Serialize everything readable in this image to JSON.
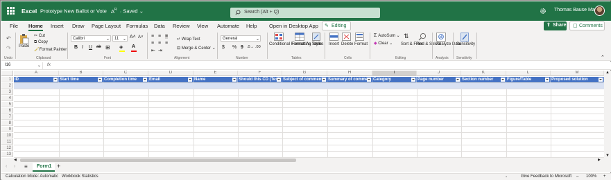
{
  "app": {
    "name": "Excel",
    "doc_title": "Prototype New Ballot or Vote",
    "sensitivity_mark": "A",
    "saved": "Saved"
  },
  "search": {
    "placeholder": "Search (Alt + Q)"
  },
  "user": {
    "name": "Thomas Bause Ma..."
  },
  "menu": {
    "tabs": [
      "File",
      "Home",
      "Insert",
      "Draw",
      "Page Layout",
      "Formulas",
      "Data",
      "Review",
      "View",
      "Automate",
      "Help",
      "Open in Desktop App"
    ],
    "active": "Home",
    "editing_label": "Editing",
    "share_label": "Share",
    "comments_label": "Comments"
  },
  "ribbon": {
    "undo_group": "Undo",
    "clipboard": {
      "paste": "Paste",
      "cut": "Cut",
      "copy": "Copy",
      "format_painter": "Format Painter",
      "group": "Clipboard"
    },
    "font": {
      "family": "Calibri",
      "size": "11",
      "bold": "B",
      "italic": "I",
      "underline": "U",
      "strike": "ab",
      "group": "Font"
    },
    "alignment": {
      "wrap_text": "Wrap Text",
      "merge_center": "Merge & Center",
      "group": "Alignment"
    },
    "number": {
      "format": "General",
      "currency": "$",
      "percent": "%",
      "comma": "9",
      "group": "Number"
    },
    "tables": {
      "conditional": "Conditional Formatting",
      "format_as": "Format As Table",
      "styles": "Styles",
      "group": "Tables"
    },
    "cells": {
      "insert": "Insert",
      "delete": "Delete",
      "format": "Format",
      "group": "Cells"
    },
    "editing": {
      "autosum": "AutoSum",
      "clear": "Clear",
      "sort_filter": "Sort & Filter",
      "find_select": "Find & Select",
      "group": "Editing"
    },
    "analysis": {
      "analyze": "Analyze Data",
      "group": "Analysis"
    },
    "sensitivity": {
      "label": "Sensitivity",
      "group": "Sensitivity"
    }
  },
  "formula_bar": {
    "cell_ref": "I16",
    "fx": "fx",
    "content": ""
  },
  "grid": {
    "columns": [
      "A",
      "B",
      "C",
      "D",
      "E",
      "F",
      "G",
      "H",
      "I",
      "J",
      "K",
      "L",
      "M"
    ],
    "selected_column": "I",
    "rows": [
      "1",
      "2",
      "3",
      "4",
      "5",
      "6",
      "7",
      "8",
      "9",
      "10",
      "11",
      "12",
      "13"
    ],
    "headers": [
      "ID",
      "Start time",
      "Completion time",
      "Email",
      "Name",
      "Should this CD (Test",
      "Subject of comment",
      "Summary of comme",
      "Category",
      "Page number",
      "Section number",
      "Figure/Table",
      "Proposed solution"
    ]
  },
  "sheets": {
    "tabs": [
      "Form1"
    ],
    "active": "Form1",
    "add": "+"
  },
  "status": {
    "calc_mode": "Calculation Mode: Automatic",
    "workbook_stats": "Workbook Statistics",
    "feedback": "Give Feedback to Microsoft",
    "zoom": "100%"
  },
  "colors": {
    "brand": "#217346",
    "table_header": "#4472c4",
    "band": "#d9e1f2"
  }
}
